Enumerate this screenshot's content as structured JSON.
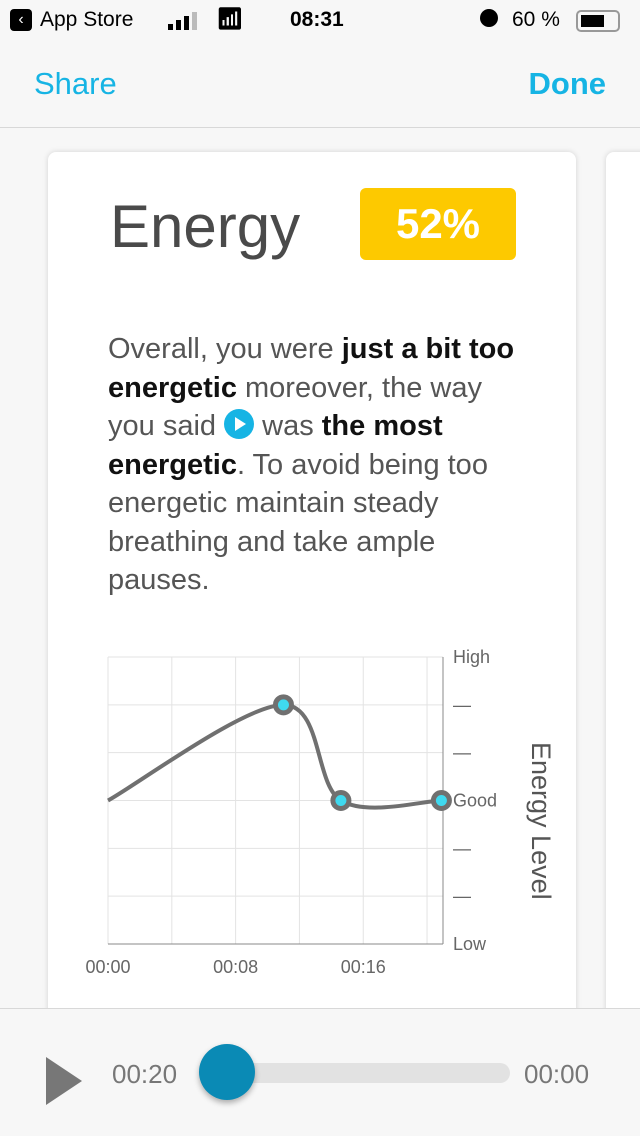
{
  "status_bar": {
    "back_app": "App Store",
    "time": "08:31",
    "battery": "60 %",
    "battery_level": 0.6
  },
  "nav": {
    "share": "Share",
    "done": "Done"
  },
  "card": {
    "title": "Energy",
    "score": "52%",
    "score_color": "#fdc900",
    "description": {
      "p1": "Overall, you were ",
      "b1": "just a bit too energetic",
      "p2": " moreover, the way you said ",
      "p3": " was ",
      "b2": "the most energetic",
      "p4": ". To avoid being too energetic maintain steady breathing and take ample pauses."
    }
  },
  "chart_data": {
    "type": "line",
    "x_unit": "seconds",
    "x": [
      0,
      11,
      14.6,
      20.9
    ],
    "y": [
      3,
      5,
      3,
      3
    ],
    "markers_at": [
      1,
      2,
      3
    ],
    "x_ticks": [
      {
        "value": 0,
        "label": "00:00"
      },
      {
        "value": 8,
        "label": "00:08"
      },
      {
        "value": 16,
        "label": "00:16"
      }
    ],
    "xlim": [
      0,
      21
    ],
    "ylim": [
      0,
      6
    ],
    "y_ticks": [
      {
        "value": 6,
        "label": "High"
      },
      {
        "value": 5,
        "label": "—"
      },
      {
        "value": 4,
        "label": "—"
      },
      {
        "value": 3,
        "label": "Good"
      },
      {
        "value": 2,
        "label": "—"
      },
      {
        "value": 1,
        "label": "—"
      },
      {
        "value": 0,
        "label": "Low"
      }
    ],
    "ylabel": "Energy Level",
    "grid": true,
    "line_color": "#707070",
    "marker_color": "#3fd9ef"
  },
  "player": {
    "current": "00:20",
    "remaining": "00:00",
    "progress": 0
  }
}
